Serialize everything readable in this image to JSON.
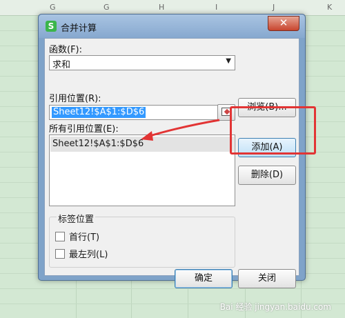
{
  "spreadsheet": {
    "columns": [
      "G",
      "H",
      "I",
      "J",
      "K"
    ]
  },
  "dialog": {
    "title": "合并计算",
    "app_icon": "S",
    "close_label": "✕",
    "function_label": "函数(F):",
    "function_value": "求和",
    "ref_label": "引用位置(R):",
    "ref_value": "Sheet12!$A$1:$D$6",
    "all_refs_label": "所有引用位置(E):",
    "all_refs": [
      "Sheet12!$A$1:$D$6"
    ],
    "browse_button": "浏览(B)...",
    "add_button": "添加(A)",
    "delete_button": "删除(D)",
    "label_group_title": "标签位置",
    "first_row_label": "首行(T)",
    "left_col_label": "最左列(L)",
    "ok_button": "确定",
    "close_button": "关闭"
  },
  "annotation": {
    "highlight_color": "#e23434"
  },
  "watermark": "Bai 经验 jingyan.baidu.com"
}
